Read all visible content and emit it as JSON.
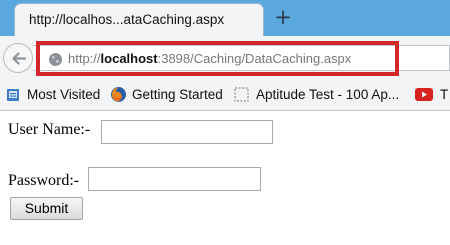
{
  "browser": {
    "tab_title": "http://localhos...ataCaching.aspx",
    "new_tab_label": "+",
    "url_prefix": "http://",
    "url_host": "localhost",
    "url_rest": ":3898/Caching/DataCaching.aspx"
  },
  "bookmarks": [
    {
      "label": "Most Visited",
      "icon": "bookmarks-folder-icon"
    },
    {
      "label": "Getting Started",
      "icon": "firefox-icon"
    },
    {
      "label": "Aptitude Test - 100 Ap...",
      "icon": "page-placeholder-icon"
    },
    {
      "label": "T",
      "icon": "youtube-icon"
    }
  ],
  "form": {
    "username_label": "User Name:-",
    "username_value": "",
    "password_label": "Password:-",
    "password_value": "",
    "submit_label": "Submit"
  },
  "colors": {
    "tabstrip": "#5aa8dd",
    "highlight": "#d2262b"
  }
}
